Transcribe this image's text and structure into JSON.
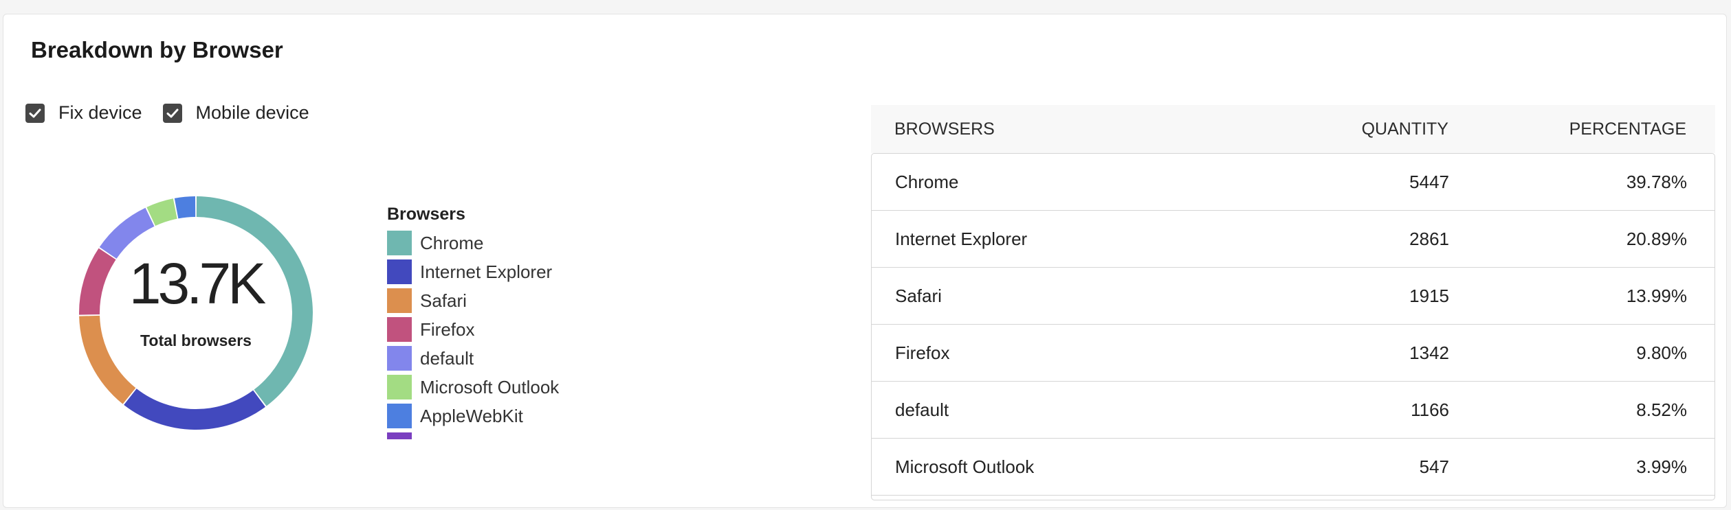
{
  "title": "Breakdown by Browser",
  "filters": [
    {
      "label": "Fix device",
      "checked": true
    },
    {
      "label": "Mobile device",
      "checked": true
    }
  ],
  "summary": {
    "value": "13.7K",
    "label": "Total browsers"
  },
  "legend": {
    "title": "Browsers",
    "items": [
      {
        "label": "Chrome",
        "color": "#6fb7b0"
      },
      {
        "label": "Internet Explorer",
        "color": "#4249be"
      },
      {
        "label": "Safari",
        "color": "#dc8f4e"
      },
      {
        "label": "Firefox",
        "color": "#c1527e"
      },
      {
        "label": "default",
        "color": "#8286ec"
      },
      {
        "label": "Microsoft Outlook",
        "color": "#a3dc83"
      },
      {
        "label": "AppleWebKit",
        "color": "#4d7fe0"
      },
      {
        "label": "",
        "color": "#7a3fc0"
      }
    ]
  },
  "chart_data": {
    "type": "pie",
    "donut": true,
    "center_value": "13.7K",
    "center_label": "Total browsers",
    "legend_title": "Browsers",
    "categories": [
      "Chrome",
      "Internet Explorer",
      "Safari",
      "Firefox",
      "default",
      "Microsoft Outlook",
      "AppleWebKit"
    ],
    "values": [
      39.78,
      20.89,
      13.99,
      9.8,
      8.52,
      3.99,
      3.03
    ],
    "colors": [
      "#6fb7b0",
      "#4249be",
      "#dc8f4e",
      "#c1527e",
      "#8286ec",
      "#a3dc83",
      "#4d7fe0"
    ]
  },
  "table": {
    "columns": [
      "BROWSERS",
      "QUANTITY",
      "PERCENTAGE"
    ],
    "rows": [
      {
        "browser": "Chrome",
        "quantity": "5447",
        "percentage": "39.78%"
      },
      {
        "browser": "Internet Explorer",
        "quantity": "2861",
        "percentage": "20.89%"
      },
      {
        "browser": "Safari",
        "quantity": "1915",
        "percentage": "13.99%"
      },
      {
        "browser": "Firefox",
        "quantity": "1342",
        "percentage": "9.80%"
      },
      {
        "browser": "default",
        "quantity": "1166",
        "percentage": "8.52%"
      },
      {
        "browser": "Microsoft Outlook",
        "quantity": "547",
        "percentage": "3.99%"
      }
    ]
  }
}
